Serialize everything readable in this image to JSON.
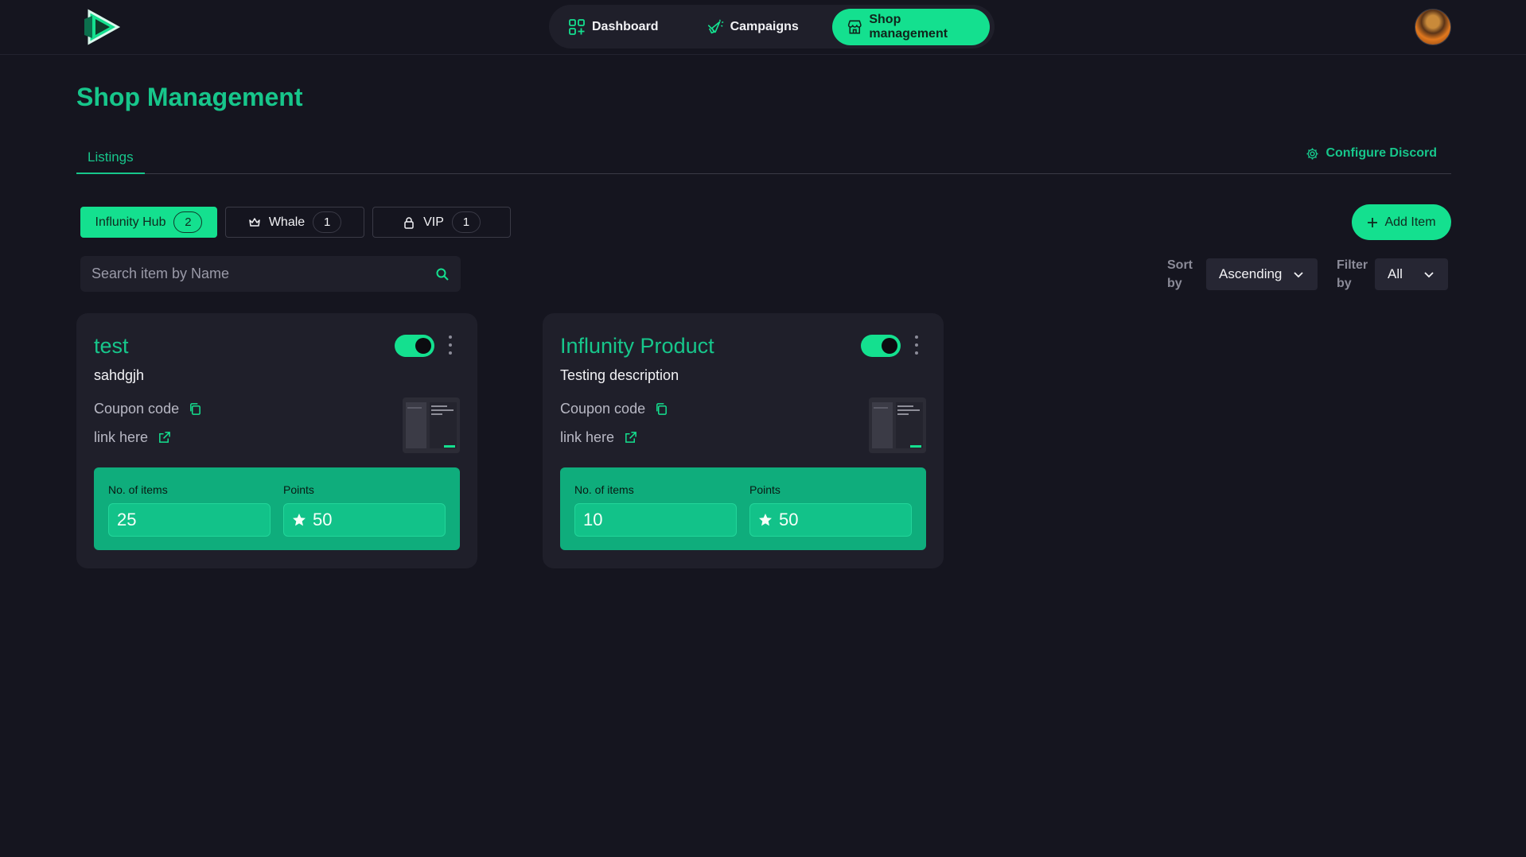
{
  "nav": {
    "items": [
      {
        "label": "Dashboard",
        "icon": "grid-plus-icon"
      },
      {
        "label": "Campaigns",
        "icon": "megaphone-icon"
      },
      {
        "label": "Shop management",
        "icon": "storefront-icon"
      }
    ],
    "active": "Shop management"
  },
  "page": {
    "title": "Shop Management"
  },
  "tabs": {
    "listings": "Listings",
    "configure": "Configure Discord"
  },
  "categories": [
    {
      "label": "Influnity Hub",
      "count": "2"
    },
    {
      "label": "Whale",
      "count": "1",
      "icon": "crown-icon"
    },
    {
      "label": "VIP",
      "count": "1",
      "icon": "lock-icon"
    }
  ],
  "add_button": {
    "label": "Add Item"
  },
  "search": {
    "placeholder": "Search item by Name",
    "value": ""
  },
  "sort": {
    "label": "Sort by",
    "value": "Ascending"
  },
  "filter": {
    "label": "Filter by",
    "value": "All"
  },
  "cards": [
    {
      "title": "test",
      "description": "sahdgjh",
      "enabled": true,
      "coupon_label": "Coupon code",
      "link_label": "link here",
      "items_label": "No. of items",
      "items_value": "25",
      "points_label": "Points",
      "points_value": "50"
    },
    {
      "title": "Influnity Product",
      "description": "Testing description",
      "enabled": true,
      "coupon_label": "Coupon code",
      "link_label": "link here",
      "items_label": "No. of items",
      "items_value": "10",
      "points_label": "Points",
      "points_value": "50"
    }
  ],
  "colors": {
    "accent": "#14e08f",
    "background": "#15151f",
    "card": "#1f1f2a"
  }
}
